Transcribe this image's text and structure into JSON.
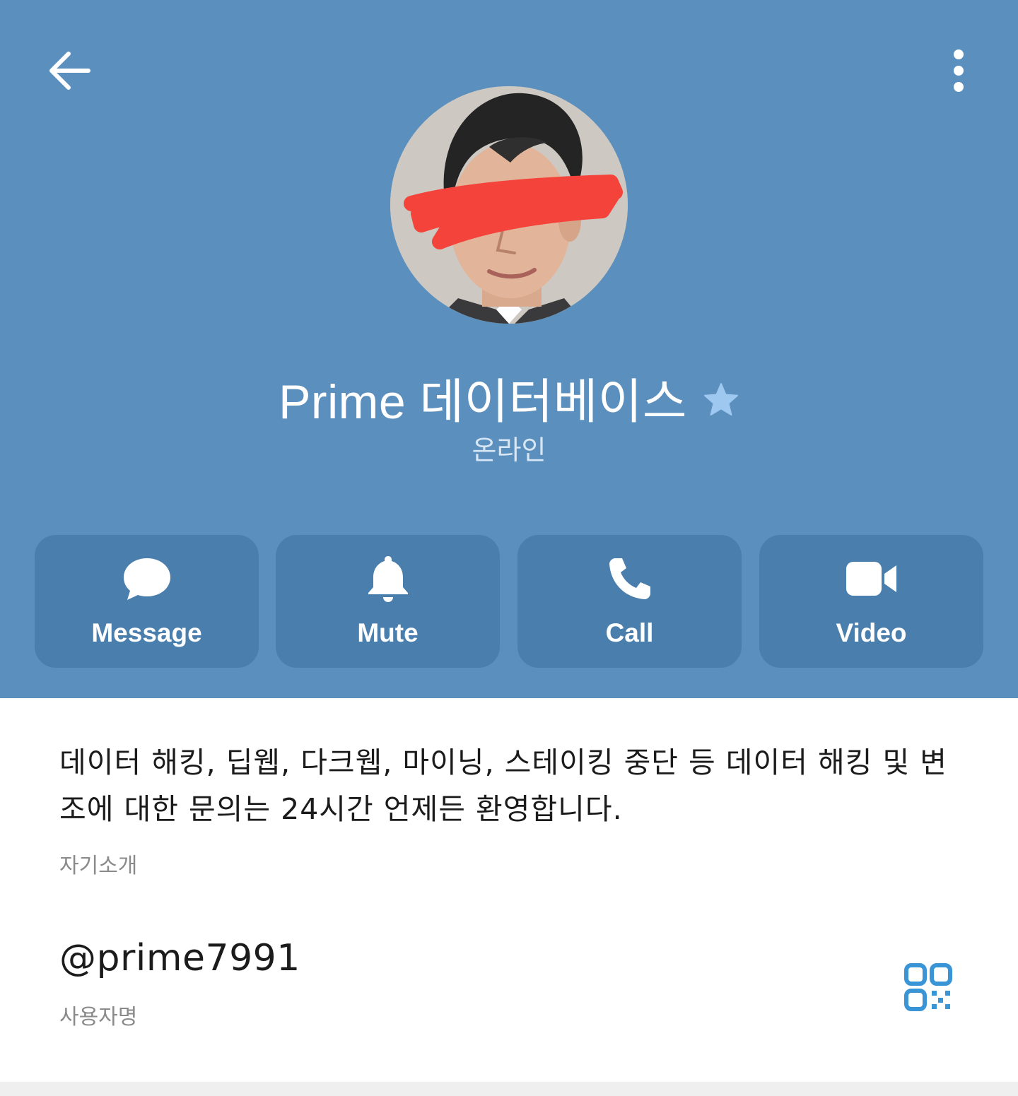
{
  "header": {
    "back_icon": "arrow-left-icon",
    "menu_icon": "more-vertical-icon",
    "background_color": "#5b8fbd"
  },
  "profile": {
    "name": "Prime 데이터베이스",
    "badge_icon": "star-icon",
    "status": "온라인"
  },
  "actions": [
    {
      "label": "Message",
      "icon": "chat-bubble-icon"
    },
    {
      "label": "Mute",
      "icon": "bell-icon"
    },
    {
      "label": "Call",
      "icon": "phone-icon"
    },
    {
      "label": "Video",
      "icon": "video-camera-icon"
    }
  ],
  "info": {
    "bio": "데이터 해킹, 딥웹, 다크웹, 마이닝, 스테이킹 중단 등 데이터 해킹 및 변조에 대한 문의는 24시간 언제든 환영합니다.",
    "bio_caption": "자기소개",
    "username": "@prime7991",
    "username_caption": "사용자명",
    "qr_icon": "qr-code-icon"
  },
  "colors": {
    "accent": "#3a95d6",
    "button_bg": "#4a7eac",
    "star": "#9fc8f0"
  }
}
